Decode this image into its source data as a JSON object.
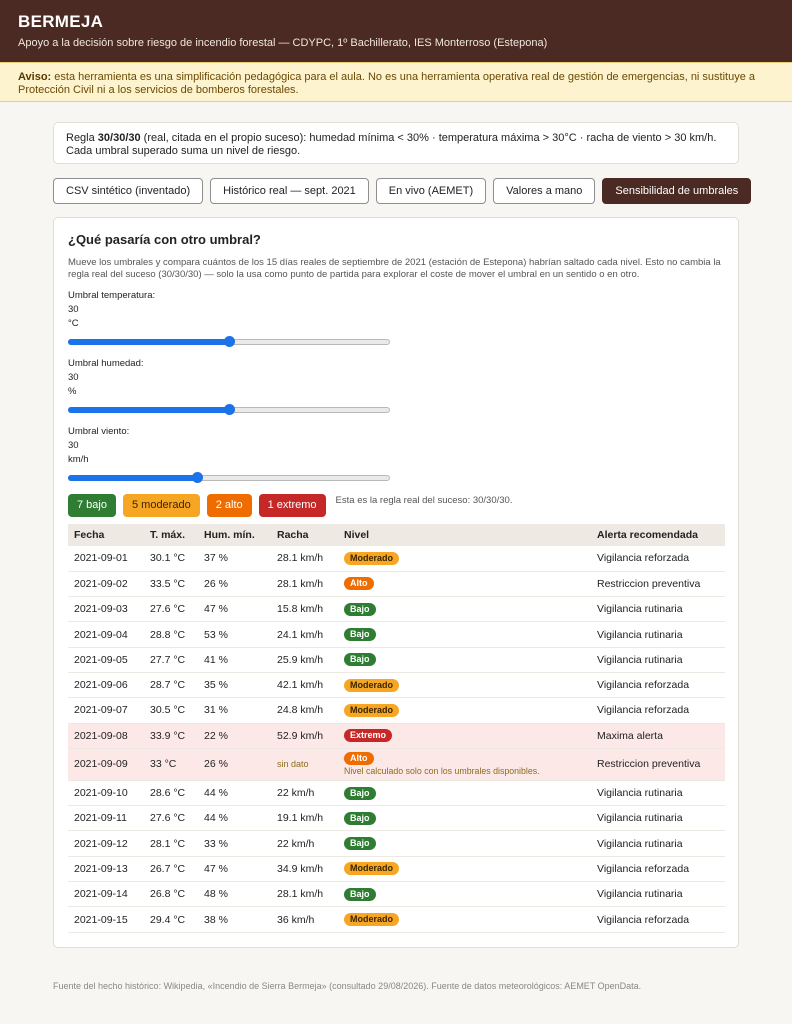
{
  "header": {
    "title": "BERMEJA",
    "subtitle": "Apoyo a la decisión sobre riesgo de incendio forestal — CDYPC, 1º Bachillerato, IES Monterroso (Estepona)"
  },
  "warning": {
    "strong": "Aviso:",
    "text": " esta herramienta es una simplificación pedagógica para el aula. No es una herramienta operativa real de gestión de emergencias, ni sustituye a Protección Civil ni a los servicios de bomberos forestales."
  },
  "rule": {
    "prefix": "Regla ",
    "strong": "30/30/30",
    "text": " (real, citada en el propio suceso): humedad mínima < 30% · temperatura máxima > 30°C · racha de viento > 30 km/h. Cada umbral superado suma un nivel de riesgo."
  },
  "tabs": [
    {
      "label": "CSV sintético (inventado)",
      "active": false
    },
    {
      "label": "Histórico real — sept. 2021",
      "active": false
    },
    {
      "label": "En vivo (AEMET)",
      "active": false
    },
    {
      "label": "Valores a mano",
      "active": false
    },
    {
      "label": "Sensibilidad de umbrales",
      "active": true
    }
  ],
  "panel": {
    "title": "¿Qué pasaría con otro umbral?",
    "description": "Mueve los umbrales y compara cuántos de los 15 días reales de septiembre de 2021 (estación de Estepona) habrían saltado cada nivel. Esto no cambia la regla real del suceso (30/30/30) — solo la usa como punto de partida para explorar el coste de mover el umbral en un sentido o en otro."
  },
  "sliders": {
    "temperatura": {
      "label": "Umbral temperatura:",
      "value": "30",
      "unit": "°C",
      "fraction": 0.5
    },
    "humedad": {
      "label": "Umbral humedad:",
      "value": "30",
      "unit": "%",
      "fraction": 0.5
    },
    "viento": {
      "label": "Umbral viento:",
      "value": "30",
      "unit": "km/h",
      "fraction": 0.4
    }
  },
  "counts": {
    "bajo": "7 bajo",
    "moderado": "5 moderado",
    "alto": "2 alto",
    "extremo": "1 extremo",
    "note": "Esta es la regla real del suceso: 30/30/30."
  },
  "table": {
    "headers": [
      "Fecha",
      "T. máx.",
      "Hum. mín.",
      "Racha",
      "Nivel",
      "Alerta recomendada"
    ],
    "rows": [
      {
        "fecha": "2021-09-01",
        "tmax": "30.1 °C",
        "hum": "37 %",
        "racha": "28.1 km/h",
        "nivel": "Moderado",
        "cls": "moderado",
        "alerta": "Vigilancia reforzada"
      },
      {
        "fecha": "2021-09-02",
        "tmax": "33.5 °C",
        "hum": "26 %",
        "racha": "28.1 km/h",
        "nivel": "Alto",
        "cls": "alto",
        "alerta": "Restriccion preventiva"
      },
      {
        "fecha": "2021-09-03",
        "tmax": "27.6 °C",
        "hum": "47 %",
        "racha": "15.8 km/h",
        "nivel": "Bajo",
        "cls": "bajo",
        "alerta": "Vigilancia rutinaria"
      },
      {
        "fecha": "2021-09-04",
        "tmax": "28.8 °C",
        "hum": "53 %",
        "racha": "24.1 km/h",
        "nivel": "Bajo",
        "cls": "bajo",
        "alerta": "Vigilancia rutinaria"
      },
      {
        "fecha": "2021-09-05",
        "tmax": "27.7 °C",
        "hum": "41 %",
        "racha": "25.9 km/h",
        "nivel": "Bajo",
        "cls": "bajo",
        "alerta": "Vigilancia rutinaria"
      },
      {
        "fecha": "2021-09-06",
        "tmax": "28.7 °C",
        "hum": "35 %",
        "racha": "42.1 km/h",
        "nivel": "Moderado",
        "cls": "moderado",
        "alerta": "Vigilancia reforzada"
      },
      {
        "fecha": "2021-09-07",
        "tmax": "30.5 °C",
        "hum": "31 %",
        "racha": "24.8 km/h",
        "nivel": "Moderado",
        "cls": "moderado",
        "alerta": "Vigilancia reforzada"
      },
      {
        "fecha": "2021-09-08",
        "tmax": "33.9 °C",
        "hum": "22 %",
        "racha": "52.9 km/h",
        "nivel": "Extremo",
        "cls": "extremo",
        "alerta": "Maxima alerta",
        "highlight": true
      },
      {
        "fecha": "2021-09-09",
        "tmax": "33 °C",
        "hum": "26 %",
        "racha": "sin dato",
        "missing": true,
        "nivel": "Alto",
        "cls": "alto",
        "nivel_note": "Nivel calculado solo con los umbrales disponibles.",
        "alerta": "Restriccion preventiva",
        "highlight": true
      },
      {
        "fecha": "2021-09-10",
        "tmax": "28.6 °C",
        "hum": "44 %",
        "racha": "22 km/h",
        "nivel": "Bajo",
        "cls": "bajo",
        "alerta": "Vigilancia rutinaria"
      },
      {
        "fecha": "2021-09-11",
        "tmax": "27.6 °C",
        "hum": "44 %",
        "racha": "19.1 km/h",
        "nivel": "Bajo",
        "cls": "bajo",
        "alerta": "Vigilancia rutinaria"
      },
      {
        "fecha": "2021-09-12",
        "tmax": "28.1 °C",
        "hum": "33 %",
        "racha": "22 km/h",
        "nivel": "Bajo",
        "cls": "bajo",
        "alerta": "Vigilancia rutinaria"
      },
      {
        "fecha": "2021-09-13",
        "tmax": "26.7 °C",
        "hum": "47 %",
        "racha": "34.9 km/h",
        "nivel": "Moderado",
        "cls": "moderado",
        "alerta": "Vigilancia reforzada"
      },
      {
        "fecha": "2021-09-14",
        "tmax": "26.8 °C",
        "hum": "48 %",
        "racha": "28.1 km/h",
        "nivel": "Bajo",
        "cls": "bajo",
        "alerta": "Vigilancia rutinaria"
      },
      {
        "fecha": "2021-09-15",
        "tmax": "29.4 °C",
        "hum": "38 %",
        "racha": "36 km/h",
        "nivel": "Moderado",
        "cls": "moderado",
        "alerta": "Vigilancia reforzada"
      }
    ]
  },
  "footer": {
    "text": "Fuente del hecho histórico: Wikipedia, «Incendio de Sierra Bermeja» (consultado 29/08/2026). Fuente de datos meteorológicos: AEMET OpenData."
  }
}
